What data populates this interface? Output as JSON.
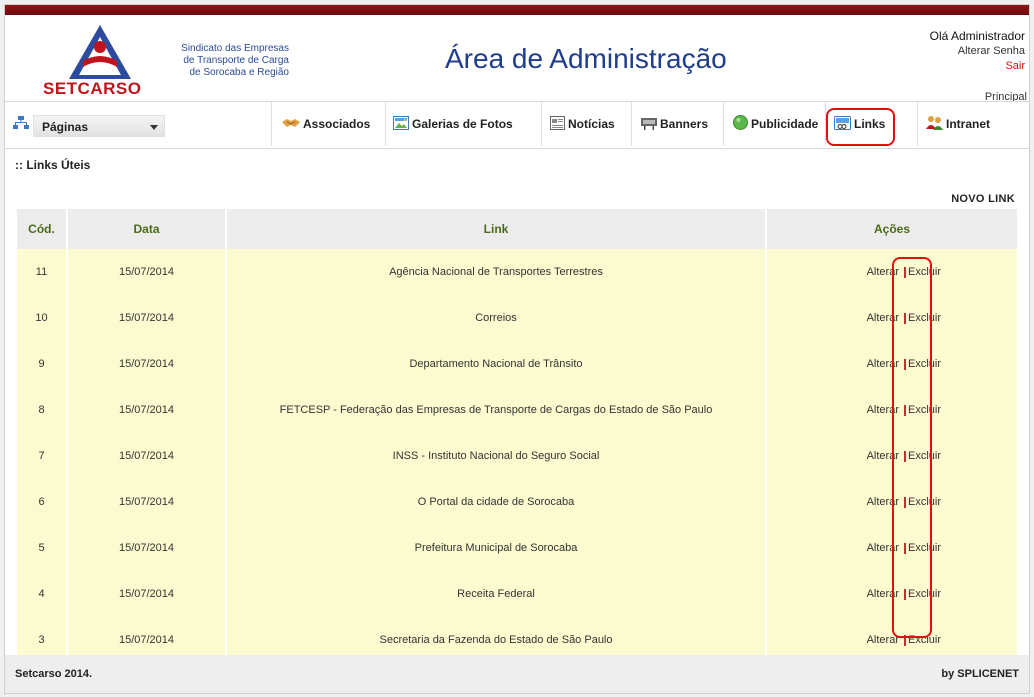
{
  "header": {
    "logo_name": "SETCARSO",
    "logo_sub1": "Sindicato das Empresas",
    "logo_sub2": "de Transporte de Carga",
    "logo_sub3": "de Sorocaba e Região",
    "title": "Área de Administração",
    "greeting": "Olá Administrador",
    "change_password": "Alterar Senha",
    "logout": "Sair",
    "principal": "Principal"
  },
  "nav": {
    "select_value": "Páginas",
    "items": [
      {
        "label": "Associados",
        "icon": "handshake-icon"
      },
      {
        "label": "Galerias de Fotos",
        "icon": "photo-gallery-icon"
      },
      {
        "label": "Notícias",
        "icon": "news-icon"
      },
      {
        "label": "Banners",
        "icon": "banner-icon"
      },
      {
        "label": "Publicidade",
        "icon": "green-circle-icon"
      },
      {
        "label": "Links",
        "icon": "links-icon"
      },
      {
        "label": "Intranet",
        "icon": "users-icon"
      }
    ]
  },
  "page": {
    "section_title": ":: Links Úteis",
    "new_link": "NOVO LINK"
  },
  "table": {
    "headers": [
      "Cód.",
      "Data",
      "Link",
      "Ações"
    ],
    "edit_label": "Alterar",
    "delete_label": "Excluir",
    "rows": [
      {
        "cod": "11",
        "date": "15/07/2014",
        "link": "Agência Nacional de Transportes Terrestres"
      },
      {
        "cod": "10",
        "date": "15/07/2014",
        "link": "Correios"
      },
      {
        "cod": "9",
        "date": "15/07/2014",
        "link": "Departamento Nacional de Trânsito"
      },
      {
        "cod": "8",
        "date": "15/07/2014",
        "link": "FETCESP - Federação das Empresas de Transporte de Cargas do Estado de São Paulo"
      },
      {
        "cod": "7",
        "date": "15/07/2014",
        "link": "INSS - Instituto Nacional do Seguro Social"
      },
      {
        "cod": "6",
        "date": "15/07/2014",
        "link": "O Portal da cidade de Sorocaba"
      },
      {
        "cod": "5",
        "date": "15/07/2014",
        "link": "Prefeitura Municipal de Sorocaba"
      },
      {
        "cod": "4",
        "date": "15/07/2014",
        "link": "Receita Federal"
      },
      {
        "cod": "3",
        "date": "15/07/2014",
        "link": "Secretaria da Fazenda do Estado de São Paulo"
      }
    ]
  },
  "footer": {
    "left": "Setcarso 2014.",
    "right": "by SPLICENET"
  },
  "colors": {
    "brand_red": "#c0141c",
    "brand_blue": "#1f3d8a",
    "row_bg": "#fbfbcf",
    "header_text": "#4a6b1a",
    "highlight": "#e01010"
  }
}
